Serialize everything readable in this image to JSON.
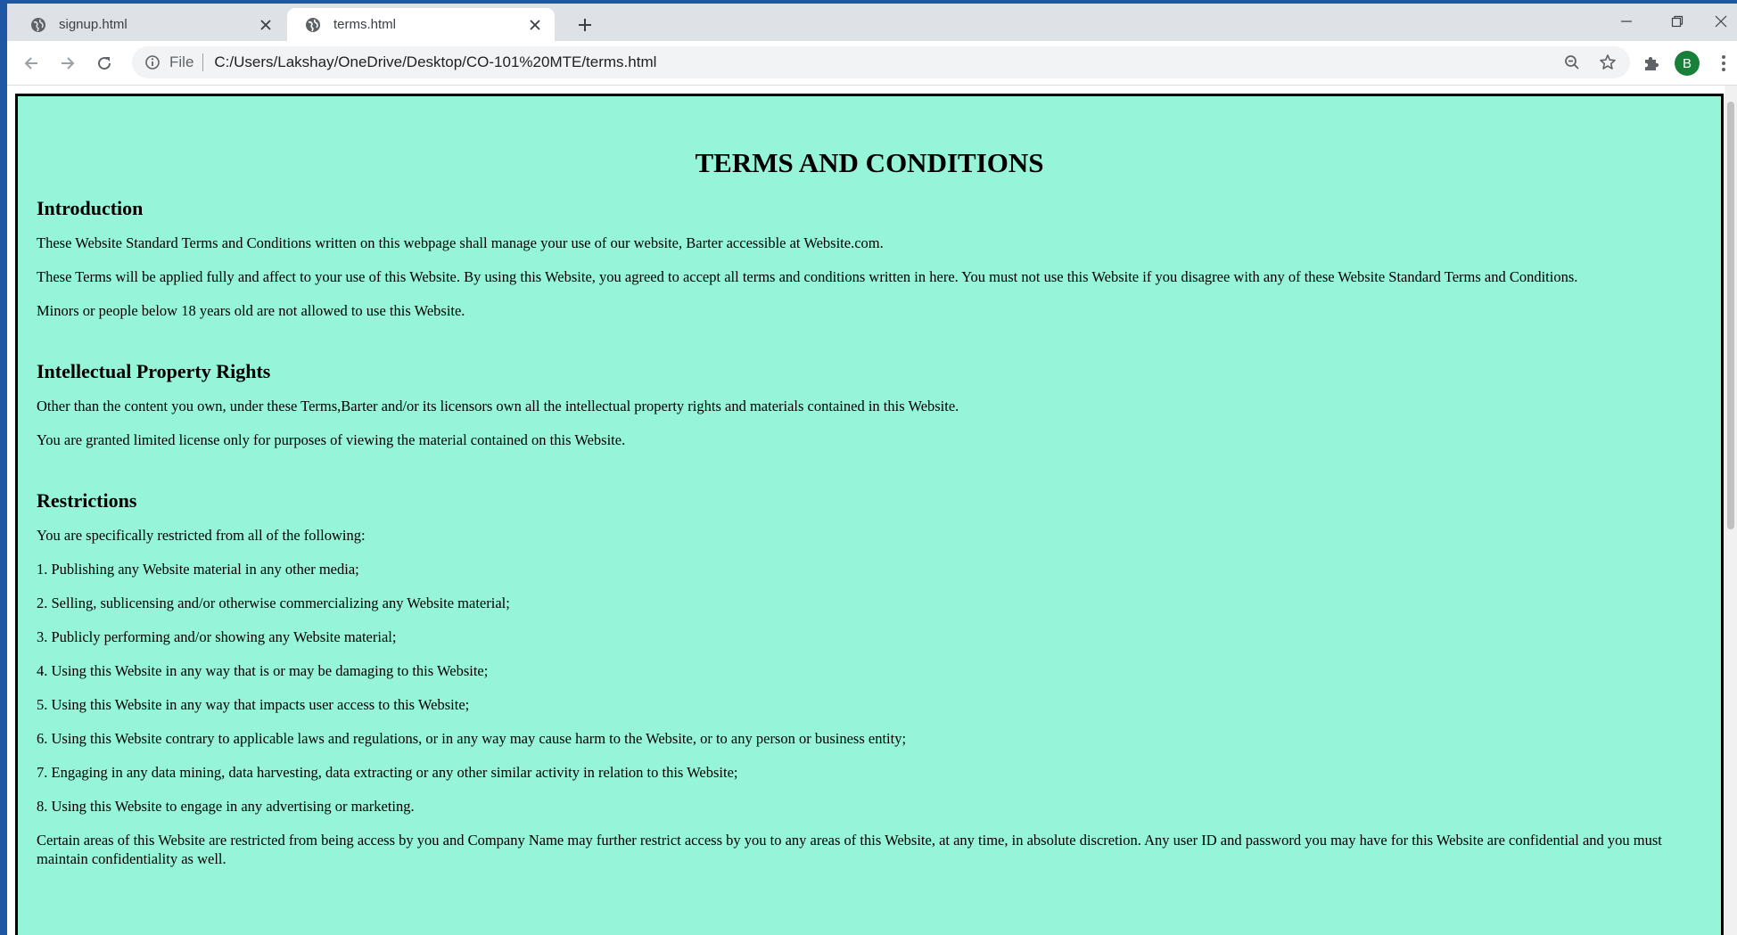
{
  "browser": {
    "tabs": [
      {
        "title": "signup.html",
        "active": false
      },
      {
        "title": "terms.html",
        "active": true
      }
    ],
    "address": {
      "scheme": "File",
      "url": "C:/Users/Lakshay/OneDrive/Desktop/CO-101%20MTE/terms.html"
    },
    "profile_initial": "B",
    "colors": {
      "profile": "#188038",
      "page_background": "#96f4d8",
      "desktop": "#1f57a5"
    }
  },
  "page": {
    "title": "TERMS AND CONDITIONS",
    "sections": [
      {
        "heading": "Introduction",
        "paragraphs": [
          "These Website Standard Terms and Conditions written on this webpage shall manage your use of our website, Barter accessible at Website.com.",
          "These Terms will be applied fully and affect to your use of this Website. By using this Website, you agreed to accept all terms and conditions written in here. You must not use this Website if you disagree with any of these Website Standard Terms and Conditions.",
          "Minors or people below 18 years old are not allowed to use this Website."
        ]
      },
      {
        "heading": "Intellectual Property Rights",
        "paragraphs": [
          "Other than the content you own, under these Terms,Barter and/or its licensors own all the intellectual property rights and materials contained in this Website.",
          "You are granted limited license only for purposes of viewing the material contained on this Website."
        ]
      },
      {
        "heading": "Restrictions",
        "paragraphs": [
          "You are specifically restricted from all of the following:",
          "1. Publishing any Website material in any other media;",
          "2. Selling, sublicensing and/or otherwise commercializing any Website material;",
          "3. Publicly performing and/or showing any Website material;",
          "4. Using this Website in any way that is or may be damaging to this Website;",
          "5. Using this Website in any way that impacts user access to this Website;",
          "6. Using this Website contrary to applicable laws and regulations, or in any way may cause harm to the Website, or to any person or business entity;",
          "7. Engaging in any data mining, data harvesting, data extracting or any other similar activity in relation to this Website;",
          "8. Using this Website to engage in any advertising or marketing.",
          "Certain areas of this Website are restricted from being access by you and Company Name may further restrict access by you to any areas of this Website, at any time, in absolute discretion. Any user ID and password you may have for this Website are confidential and you must maintain confidentiality as well."
        ]
      }
    ]
  }
}
